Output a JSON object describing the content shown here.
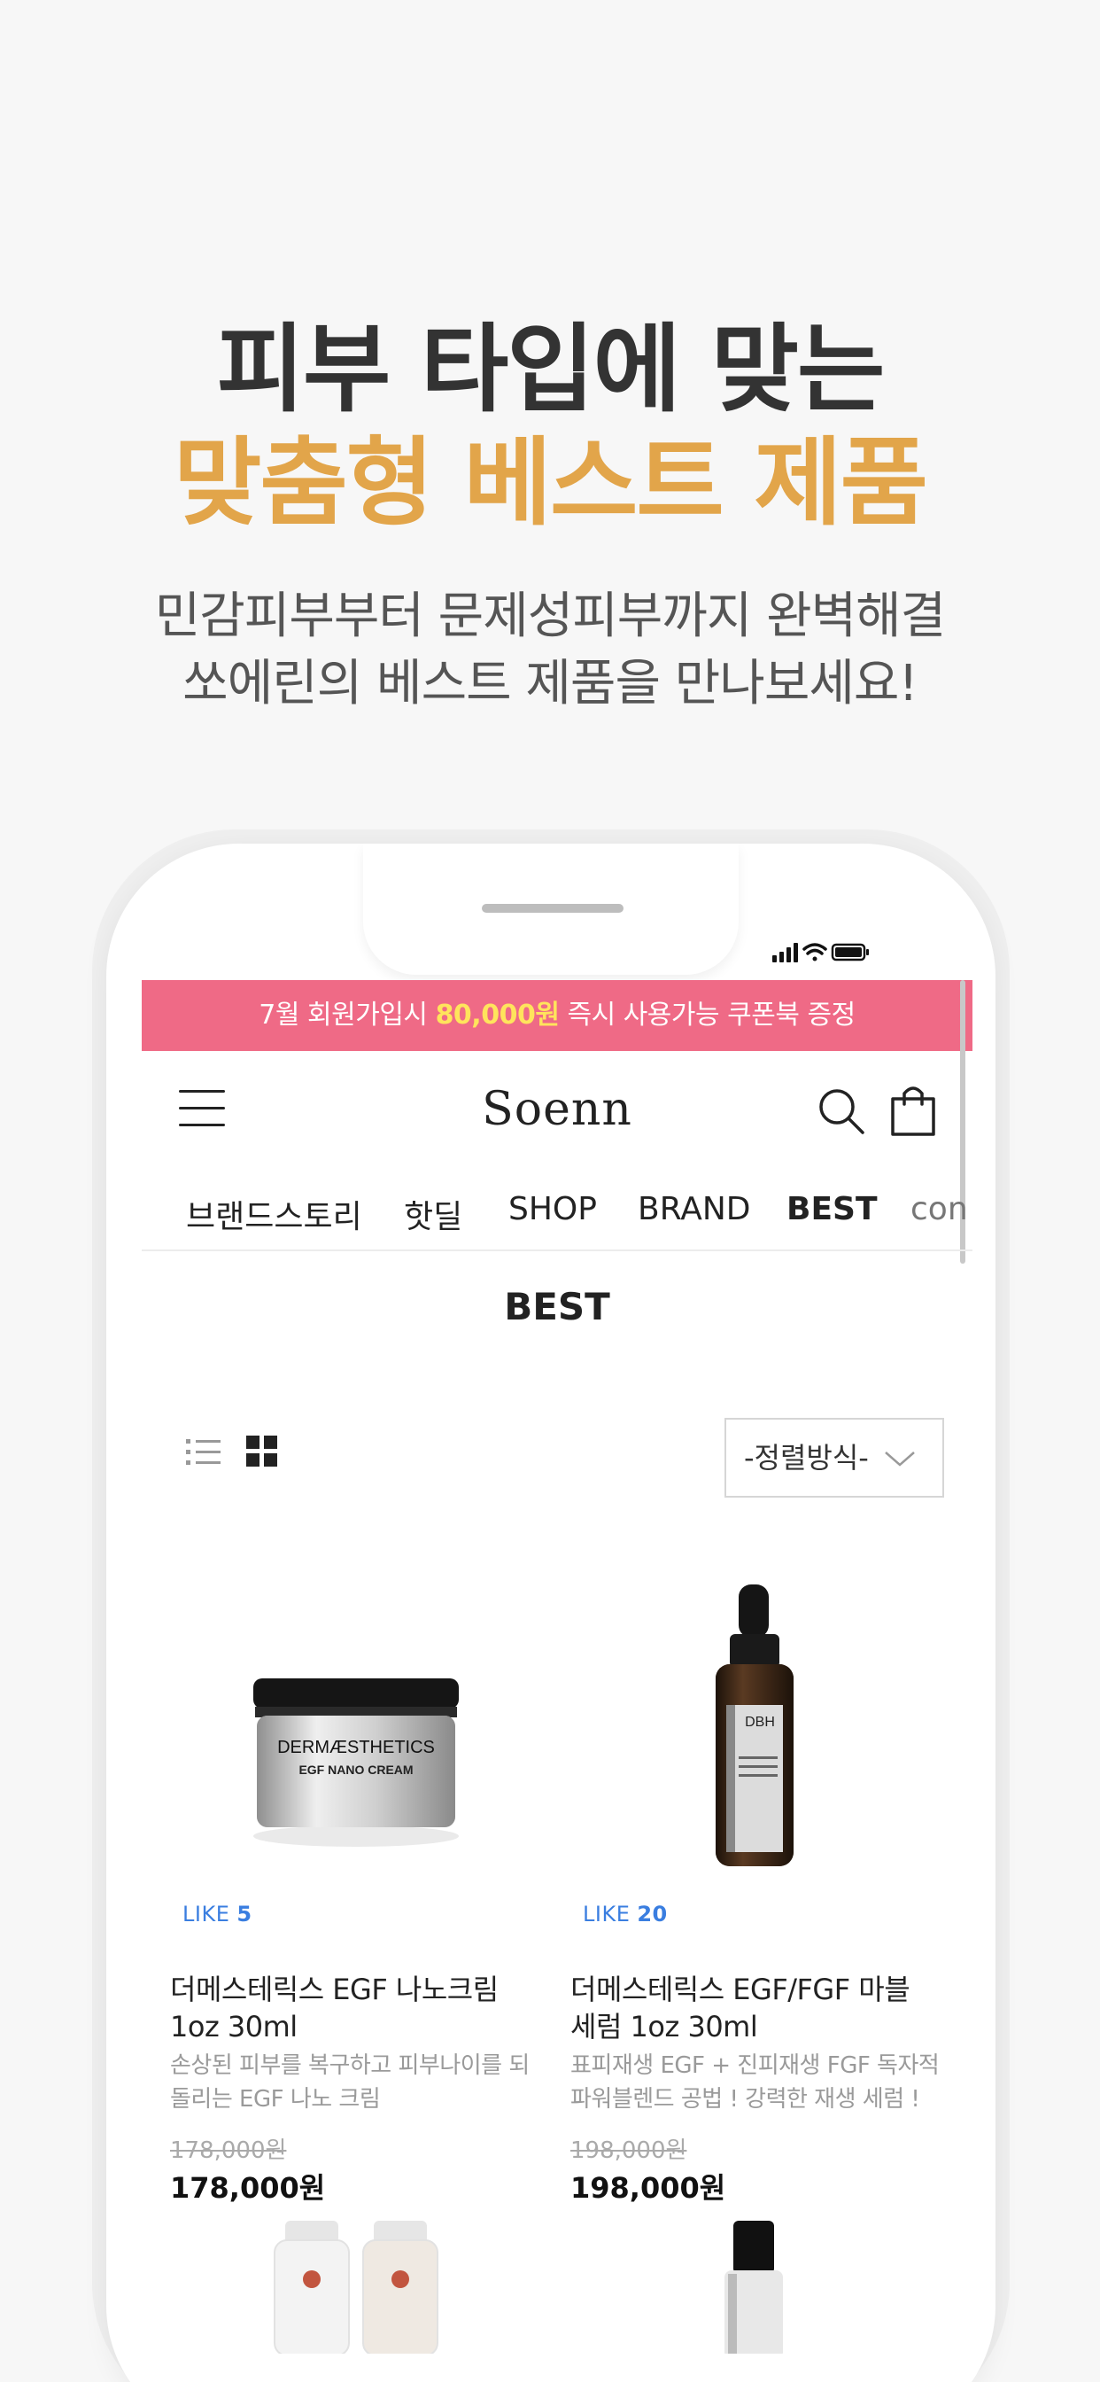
{
  "promo": {
    "headline_line1": "피부 타입에 맞는",
    "headline_line2": "맞춤형 베스트 제품",
    "sub_line1": "민감피부부터 문제성피부까지 완벽해결",
    "sub_line2": "쏘에린의 베스트 제품을 만나보세요!",
    "accent_color": "#e2a54a"
  },
  "banner": {
    "text_before": "7월 회원가입시 ",
    "highlight": "80,000원",
    "text_after": " 즉시 사용가능 쿠폰북 증정",
    "bg_color": "#ef6a86"
  },
  "header": {
    "logo": "Soenn",
    "menu_icon": "hamburger-icon",
    "search_icon": "search-icon",
    "cart_icon": "shopping-bag-icon"
  },
  "nav": {
    "items": [
      "브랜드스토리",
      "핫딜",
      "SHOP",
      "BRAND",
      "BEST",
      "con"
    ],
    "active": "BEST"
  },
  "page": {
    "title": "BEST",
    "sort_label": "-정렬방식-"
  },
  "products": [
    {
      "like_label": "LIKE",
      "like_count": "5",
      "name": "더메스테릭스 EGF 나노크림 1oz 30ml",
      "desc": "손상된 피부를 복구하고 피부나이를 되돌리는 EGF 나노 크림",
      "old_price": "178,000원",
      "price": "178,000원",
      "jar_label_top": "DERMÆSTHETICS",
      "jar_label_bottom": "EGF NANO CREAM"
    },
    {
      "like_label": "LIKE",
      "like_count": "20",
      "name": "더메스테릭스 EGF/FGF 마블 세럼 1oz 30ml",
      "desc": "표피재생 EGF + 진피재생 FGF 독자적 파워블렌드 공법 ! 강력한 재생 세럼 !",
      "old_price": "198,000원",
      "price": "198,000원",
      "bottle_label": "DBH"
    }
  ]
}
